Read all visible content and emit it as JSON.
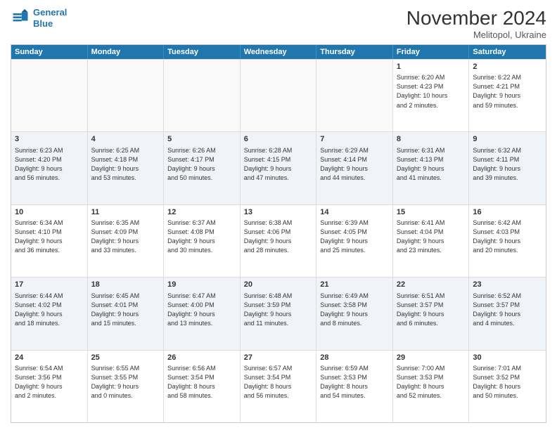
{
  "logo": {
    "line1": "General",
    "line2": "Blue"
  },
  "title": "November 2024",
  "location": "Melitopol, Ukraine",
  "days_of_week": [
    "Sunday",
    "Monday",
    "Tuesday",
    "Wednesday",
    "Thursday",
    "Friday",
    "Saturday"
  ],
  "weeks": [
    [
      {
        "day": "",
        "info": "",
        "empty": true
      },
      {
        "day": "",
        "info": "",
        "empty": true
      },
      {
        "day": "",
        "info": "",
        "empty": true
      },
      {
        "day": "",
        "info": "",
        "empty": true
      },
      {
        "day": "",
        "info": "",
        "empty": true
      },
      {
        "day": "1",
        "info": "Sunrise: 6:20 AM\nSunset: 4:23 PM\nDaylight: 10 hours\nand 2 minutes.",
        "empty": false
      },
      {
        "day": "2",
        "info": "Sunrise: 6:22 AM\nSunset: 4:21 PM\nDaylight: 9 hours\nand 59 minutes.",
        "empty": false
      }
    ],
    [
      {
        "day": "3",
        "info": "Sunrise: 6:23 AM\nSunset: 4:20 PM\nDaylight: 9 hours\nand 56 minutes.",
        "empty": false
      },
      {
        "day": "4",
        "info": "Sunrise: 6:25 AM\nSunset: 4:18 PM\nDaylight: 9 hours\nand 53 minutes.",
        "empty": false
      },
      {
        "day": "5",
        "info": "Sunrise: 6:26 AM\nSunset: 4:17 PM\nDaylight: 9 hours\nand 50 minutes.",
        "empty": false
      },
      {
        "day": "6",
        "info": "Sunrise: 6:28 AM\nSunset: 4:15 PM\nDaylight: 9 hours\nand 47 minutes.",
        "empty": false
      },
      {
        "day": "7",
        "info": "Sunrise: 6:29 AM\nSunset: 4:14 PM\nDaylight: 9 hours\nand 44 minutes.",
        "empty": false
      },
      {
        "day": "8",
        "info": "Sunrise: 6:31 AM\nSunset: 4:13 PM\nDaylight: 9 hours\nand 41 minutes.",
        "empty": false
      },
      {
        "day": "9",
        "info": "Sunrise: 6:32 AM\nSunset: 4:11 PM\nDaylight: 9 hours\nand 39 minutes.",
        "empty": false
      }
    ],
    [
      {
        "day": "10",
        "info": "Sunrise: 6:34 AM\nSunset: 4:10 PM\nDaylight: 9 hours\nand 36 minutes.",
        "empty": false
      },
      {
        "day": "11",
        "info": "Sunrise: 6:35 AM\nSunset: 4:09 PM\nDaylight: 9 hours\nand 33 minutes.",
        "empty": false
      },
      {
        "day": "12",
        "info": "Sunrise: 6:37 AM\nSunset: 4:08 PM\nDaylight: 9 hours\nand 30 minutes.",
        "empty": false
      },
      {
        "day": "13",
        "info": "Sunrise: 6:38 AM\nSunset: 4:06 PM\nDaylight: 9 hours\nand 28 minutes.",
        "empty": false
      },
      {
        "day": "14",
        "info": "Sunrise: 6:39 AM\nSunset: 4:05 PM\nDaylight: 9 hours\nand 25 minutes.",
        "empty": false
      },
      {
        "day": "15",
        "info": "Sunrise: 6:41 AM\nSunset: 4:04 PM\nDaylight: 9 hours\nand 23 minutes.",
        "empty": false
      },
      {
        "day": "16",
        "info": "Sunrise: 6:42 AM\nSunset: 4:03 PM\nDaylight: 9 hours\nand 20 minutes.",
        "empty": false
      }
    ],
    [
      {
        "day": "17",
        "info": "Sunrise: 6:44 AM\nSunset: 4:02 PM\nDaylight: 9 hours\nand 18 minutes.",
        "empty": false
      },
      {
        "day": "18",
        "info": "Sunrise: 6:45 AM\nSunset: 4:01 PM\nDaylight: 9 hours\nand 15 minutes.",
        "empty": false
      },
      {
        "day": "19",
        "info": "Sunrise: 6:47 AM\nSunset: 4:00 PM\nDaylight: 9 hours\nand 13 minutes.",
        "empty": false
      },
      {
        "day": "20",
        "info": "Sunrise: 6:48 AM\nSunset: 3:59 PM\nDaylight: 9 hours\nand 11 minutes.",
        "empty": false
      },
      {
        "day": "21",
        "info": "Sunrise: 6:49 AM\nSunset: 3:58 PM\nDaylight: 9 hours\nand 8 minutes.",
        "empty": false
      },
      {
        "day": "22",
        "info": "Sunrise: 6:51 AM\nSunset: 3:57 PM\nDaylight: 9 hours\nand 6 minutes.",
        "empty": false
      },
      {
        "day": "23",
        "info": "Sunrise: 6:52 AM\nSunset: 3:57 PM\nDaylight: 9 hours\nand 4 minutes.",
        "empty": false
      }
    ],
    [
      {
        "day": "24",
        "info": "Sunrise: 6:54 AM\nSunset: 3:56 PM\nDaylight: 9 hours\nand 2 minutes.",
        "empty": false
      },
      {
        "day": "25",
        "info": "Sunrise: 6:55 AM\nSunset: 3:55 PM\nDaylight: 9 hours\nand 0 minutes.",
        "empty": false
      },
      {
        "day": "26",
        "info": "Sunrise: 6:56 AM\nSunset: 3:54 PM\nDaylight: 8 hours\nand 58 minutes.",
        "empty": false
      },
      {
        "day": "27",
        "info": "Sunrise: 6:57 AM\nSunset: 3:54 PM\nDaylight: 8 hours\nand 56 minutes.",
        "empty": false
      },
      {
        "day": "28",
        "info": "Sunrise: 6:59 AM\nSunset: 3:53 PM\nDaylight: 8 hours\nand 54 minutes.",
        "empty": false
      },
      {
        "day": "29",
        "info": "Sunrise: 7:00 AM\nSunset: 3:53 PM\nDaylight: 8 hours\nand 52 minutes.",
        "empty": false
      },
      {
        "day": "30",
        "info": "Sunrise: 7:01 AM\nSunset: 3:52 PM\nDaylight: 8 hours\nand 50 minutes.",
        "empty": false
      }
    ]
  ]
}
